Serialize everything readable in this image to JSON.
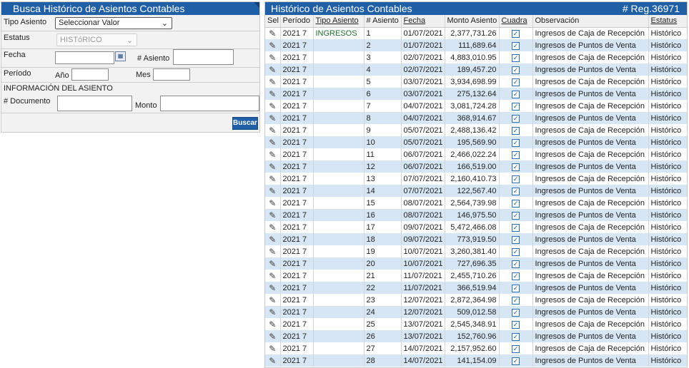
{
  "search": {
    "title": "Busca Histórico de Asientos Contables",
    "tipo_asiento_label": "Tipo Asiento",
    "tipo_asiento_value": "Seleccionar Valor",
    "estatus_label": "Estatus",
    "estatus_value": "HISTóRICO",
    "fecha_label": "Fecha",
    "asiento_label": "# Asiento",
    "periodo_label": "Período",
    "anio_label": "Año",
    "mes_label": "Mes",
    "section_label": "INFORMACIÓN DEL ASIENTO",
    "documento_label": "# Documento",
    "monto_label": "Monto",
    "buscar_label": "Buscar"
  },
  "grid": {
    "title": "Histórico de Asientos Contables",
    "reg_count": "# Reg.36971",
    "columns": [
      "Sel",
      "Período",
      "Tipo Asiento",
      "# Asiento",
      "Fecha",
      "Monto Asiento",
      "Cuadra",
      "Observación",
      "Estatus"
    ],
    "rows": [
      {
        "periodo": "2021 7",
        "tipo": "INGRESOS",
        "asiento": "1",
        "fecha": "01/07/2021",
        "monto": "2,377,731.26",
        "obs": "Ingresos de Caja de Recepción",
        "estatus": "Histórico"
      },
      {
        "periodo": "2021 7",
        "tipo": "",
        "asiento": "2",
        "fecha": "01/07/2021",
        "monto": "111,689.64",
        "obs": "Ingresos de Puntos de Venta",
        "estatus": "Histórico"
      },
      {
        "periodo": "2021 7",
        "tipo": "",
        "asiento": "3",
        "fecha": "02/07/2021",
        "monto": "4,883,010.95",
        "obs": "Ingresos de Caja de Recepción",
        "estatus": "Histórico"
      },
      {
        "periodo": "2021 7",
        "tipo": "",
        "asiento": "4",
        "fecha": "02/07/2021",
        "monto": "189,457.20",
        "obs": "Ingresos de Puntos de Venta",
        "estatus": "Histórico"
      },
      {
        "periodo": "2021 7",
        "tipo": "",
        "asiento": "5",
        "fecha": "03/07/2021",
        "monto": "3,934,698.99",
        "obs": "Ingresos de Caja de Recepción",
        "estatus": "Histórico"
      },
      {
        "periodo": "2021 7",
        "tipo": "",
        "asiento": "6",
        "fecha": "03/07/2021",
        "monto": "275,132.64",
        "obs": "Ingresos de Puntos de Venta",
        "estatus": "Histórico"
      },
      {
        "periodo": "2021 7",
        "tipo": "",
        "asiento": "7",
        "fecha": "04/07/2021",
        "monto": "3,081,724.28",
        "obs": "Ingresos de Caja de Recepción",
        "estatus": "Histórico"
      },
      {
        "periodo": "2021 7",
        "tipo": "",
        "asiento": "8",
        "fecha": "04/07/2021",
        "monto": "368,914.67",
        "obs": "Ingresos de Puntos de Venta",
        "estatus": "Histórico"
      },
      {
        "periodo": "2021 7",
        "tipo": "",
        "asiento": "9",
        "fecha": "05/07/2021",
        "monto": "2,488,136.42",
        "obs": "Ingresos de Caja de Recepción",
        "estatus": "Histórico"
      },
      {
        "periodo": "2021 7",
        "tipo": "",
        "asiento": "10",
        "fecha": "05/07/2021",
        "monto": "195,569.90",
        "obs": "Ingresos de Puntos de Venta",
        "estatus": "Histórico"
      },
      {
        "periodo": "2021 7",
        "tipo": "",
        "asiento": "11",
        "fecha": "06/07/2021",
        "monto": "2,466,022.24",
        "obs": "Ingresos de Caja de Recepción",
        "estatus": "Histórico"
      },
      {
        "periodo": "2021 7",
        "tipo": "",
        "asiento": "12",
        "fecha": "06/07/2021",
        "monto": "166,519.00",
        "obs": "Ingresos de Puntos de Venta",
        "estatus": "Histórico"
      },
      {
        "periodo": "2021 7",
        "tipo": "",
        "asiento": "13",
        "fecha": "07/07/2021",
        "monto": "2,160,410.73",
        "obs": "Ingresos de Caja de Recepción",
        "estatus": "Histórico"
      },
      {
        "periodo": "2021 7",
        "tipo": "",
        "asiento": "14",
        "fecha": "07/07/2021",
        "monto": "122,567.40",
        "obs": "Ingresos de Puntos de Venta",
        "estatus": "Histórico"
      },
      {
        "periodo": "2021 7",
        "tipo": "",
        "asiento": "15",
        "fecha": "08/07/2021",
        "monto": "2,564,739.98",
        "obs": "Ingresos de Caja de Recepción",
        "estatus": "Histórico"
      },
      {
        "periodo": "2021 7",
        "tipo": "",
        "asiento": "16",
        "fecha": "08/07/2021",
        "monto": "146,975.50",
        "obs": "Ingresos de Puntos de Venta",
        "estatus": "Histórico"
      },
      {
        "periodo": "2021 7",
        "tipo": "",
        "asiento": "17",
        "fecha": "09/07/2021",
        "monto": "5,472,466.08",
        "obs": "Ingresos de Caja de Recepción",
        "estatus": "Histórico"
      },
      {
        "periodo": "2021 7",
        "tipo": "",
        "asiento": "18",
        "fecha": "09/07/2021",
        "monto": "773,919.50",
        "obs": "Ingresos de Puntos de Venta",
        "estatus": "Histórico"
      },
      {
        "periodo": "2021 7",
        "tipo": "",
        "asiento": "19",
        "fecha": "10/07/2021",
        "monto": "3,260,381.40",
        "obs": "Ingresos de Caja de Recepción",
        "estatus": "Histórico"
      },
      {
        "periodo": "2021 7",
        "tipo": "",
        "asiento": "20",
        "fecha": "10/07/2021",
        "monto": "727,696.35",
        "obs": "Ingresos de Puntos de Venta",
        "estatus": "Histórico"
      },
      {
        "periodo": "2021 7",
        "tipo": "",
        "asiento": "21",
        "fecha": "11/07/2021",
        "monto": "2,455,710.26",
        "obs": "Ingresos de Caja de Recepción",
        "estatus": "Histórico"
      },
      {
        "periodo": "2021 7",
        "tipo": "",
        "asiento": "22",
        "fecha": "11/07/2021",
        "monto": "366,519.94",
        "obs": "Ingresos de Puntos de Venta",
        "estatus": "Histórico"
      },
      {
        "periodo": "2021 7",
        "tipo": "",
        "asiento": "23",
        "fecha": "12/07/2021",
        "monto": "2,872,364.98",
        "obs": "Ingresos de Caja de Recepción",
        "estatus": "Histórico"
      },
      {
        "periodo": "2021 7",
        "tipo": "",
        "asiento": "24",
        "fecha": "12/07/2021",
        "monto": "509,012.58",
        "obs": "Ingresos de Puntos de Venta",
        "estatus": "Histórico"
      },
      {
        "periodo": "2021 7",
        "tipo": "",
        "asiento": "25",
        "fecha": "13/07/2021",
        "monto": "2,545,348.91",
        "obs": "Ingresos de Caja de Recepción",
        "estatus": "Histórico"
      },
      {
        "periodo": "2021 7",
        "tipo": "",
        "asiento": "26",
        "fecha": "13/07/2021",
        "monto": "152,760.96",
        "obs": "Ingresos de Puntos de Venta",
        "estatus": "Histórico"
      },
      {
        "periodo": "2021 7",
        "tipo": "",
        "asiento": "27",
        "fecha": "14/07/2021",
        "monto": "2,157,952.60",
        "obs": "Ingresos de Caja de Recepción",
        "estatus": "Histórico"
      },
      {
        "periodo": "2021 7",
        "tipo": "",
        "asiento": "28",
        "fecha": "14/07/2021",
        "monto": "141,154.09",
        "obs": "Ingresos de Puntos de Venta",
        "estatus": "Histórico"
      }
    ]
  },
  "icons": {
    "edit": "pencil-icon",
    "check": "checkbox-checked-icon",
    "calendar": "calendar-icon",
    "dropdown": "chevron-down-icon"
  },
  "colors": {
    "header_blue": "#1f5fa6",
    "row_alt": "#d7e6f4"
  }
}
